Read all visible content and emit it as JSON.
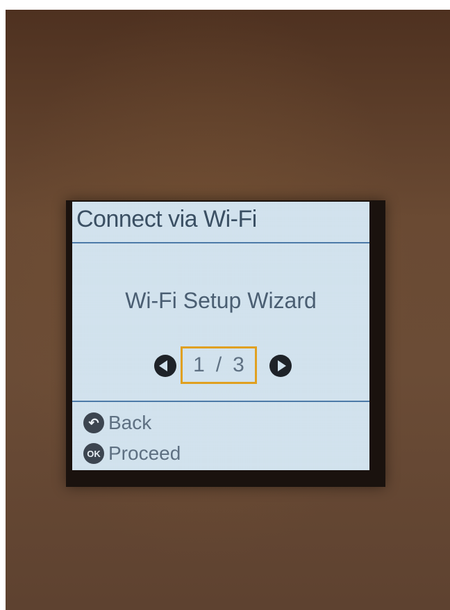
{
  "screen": {
    "title": "Connect via Wi-Fi",
    "menu_item": "Wi-Fi Setup Wizard",
    "pager": {
      "current": "1",
      "separator": "/",
      "total": "3"
    },
    "softkeys": {
      "back_label": "Back",
      "ok_key": "OK",
      "ok_label": "Proceed"
    },
    "icons": {
      "prev": "left-arrow-icon",
      "next": "right-arrow-icon",
      "back": "return-icon",
      "ok": "ok-icon"
    },
    "colors": {
      "screen_bg": "#cfe0ec",
      "divider": "#4c7aa8",
      "selection": "#e0a020"
    }
  }
}
